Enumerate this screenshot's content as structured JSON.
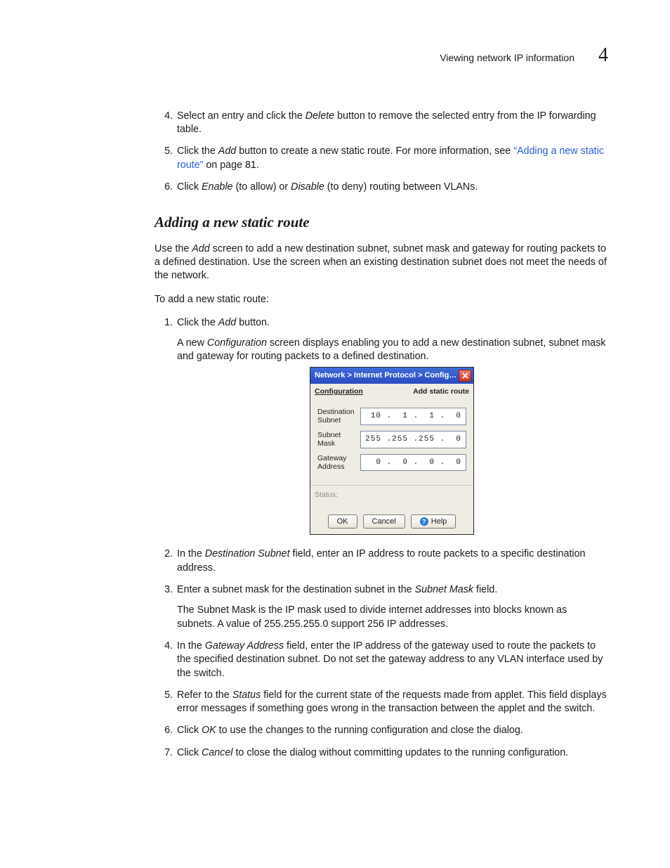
{
  "header": {
    "title": "Viewing network IP information",
    "chapter": "4"
  },
  "steps_top": {
    "start": 4,
    "items": [
      {
        "pre": "Select an entry and click the ",
        "em": "Delete",
        "post": " button to remove the selected entry from the IP forwarding table."
      },
      {
        "pre": "Click the ",
        "em": "Add",
        "post": " button to create a new static route. For more information, see ",
        "link": "“Adding a new static route”",
        "tail": " on page 81."
      },
      {
        "pre": "Click ",
        "em": "Enable",
        "mid": " (to allow) or ",
        "em2": "Disable",
        "post": " (to deny) routing between VLANs."
      }
    ]
  },
  "section_title": "Adding a new static route",
  "intro": {
    "p1_a": "Use the ",
    "p1_em": "Add",
    "p1_b": " screen to add a new destination subnet, subnet mask and gateway for routing packets to a defined destination. Use the screen when an existing destination subnet does not meet the needs of the network.",
    "p2": "To add a new static route:"
  },
  "steps_add": {
    "s1_a": "Click the ",
    "s1_em": "Add",
    "s1_b": " button.",
    "s1_sub_a": "A new ",
    "s1_sub_em": "Configuration",
    "s1_sub_b": " screen displays enabling you to add a new destination subnet, subnet mask and gateway for routing packets to a defined destination.",
    "s2_a": "In the ",
    "s2_em": "Destination Subnet",
    "s2_b": " field, enter an IP address to route packets to a specific destination address.",
    "s3_a": "Enter a subnet mask for the destination subnet in the ",
    "s3_em": "Subnet Mask",
    "s3_b": " field.",
    "s3_sub": "The Subnet Mask is the IP mask used to divide internet addresses into blocks known as subnets. A value of 255.255.255.0 support 256 IP addresses.",
    "s4_a": "In the ",
    "s4_em": "Gateway Address",
    "s4_b": " field, enter the IP address of the gateway used to route the packets to the specified destination subnet. Do not set the gateway address to any VLAN interface used by the switch.",
    "s5_a": "Refer to the ",
    "s5_em": "Status",
    "s5_b": " field for the current state of the requests made from applet. This field displays error messages if something goes wrong in the transaction between the applet and the switch.",
    "s6_a": "Click ",
    "s6_em": "OK",
    "s6_b": " to use the changes to the running configuration and close the dialog.",
    "s7_a": "Click ",
    "s7_em": "Cancel",
    "s7_b": " to close the dialog without committing updates to the running configuration."
  },
  "dialog": {
    "title": "Network > Internet Protocol > Config…",
    "head_left": "Configuration",
    "head_right": "Add static route",
    "labels": {
      "dest": "Destination\nSubnet",
      "mask": "Subnet\nMask",
      "gw": "Gateway\nAddress"
    },
    "values": {
      "dest": " 10 .  1 .  1 .  0",
      "mask": "255 .255 .255 .  0",
      "gw": "  0 .  0 .  0 .  0"
    },
    "status_label": "Status:",
    "buttons": {
      "ok": "OK",
      "cancel": "Cancel",
      "help": "Help"
    }
  }
}
